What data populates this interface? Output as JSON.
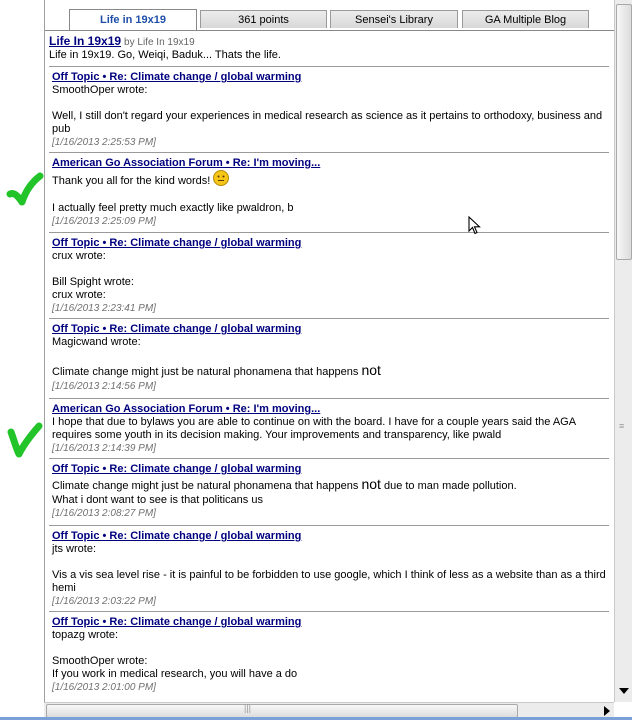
{
  "tabs": [
    {
      "label": "Life in 19x19",
      "active": true
    },
    {
      "label": "361 points",
      "active": false
    },
    {
      "label": "Sensei's Library",
      "active": false
    },
    {
      "label": "GA Multiple Blog",
      "active": false
    }
  ],
  "header": {
    "blog_title": "Life In 19x19",
    "byline": "by Life In 19x19",
    "tagline": "Life in 19x19. Go, Weiqi, Baduk... Thats the life."
  },
  "entries": [
    {
      "title": "Off Topic • Re: Climate change / global warming",
      "lines": [
        "SmoothOper wrote:",
        "",
        "Well, I still don't regard your experiences in medical research as science as it pertains to orthodoxy, business and pub"
      ],
      "stamp": "[1/16/2013 2:25:53 PM]"
    },
    {
      "title": "American Go Association Forum • Re: I'm moving...",
      "line1": "Thank you all for the kind words!",
      "line3": "I actually feel pretty much exactly like pwaldron, b",
      "stamp": "[1/16/2013 2:25:09 PM]"
    },
    {
      "title": "Off Topic • Re: Climate change / global warming",
      "lines": [
        "crux wrote:",
        "",
        "Bill Spight wrote:",
        "crux wrote:"
      ],
      "stamp": "[1/16/2013 2:23:41 PM]"
    },
    {
      "title": "Off Topic • Re: Climate change / global warming",
      "line1": "Magicwand wrote:",
      "line3_pre": "Climate change might just be natural phonamena that happens",
      "line3_big": "not",
      "stamp": "[1/16/2013 2:14:56 PM]"
    },
    {
      "title": "American Go Association Forum • Re: I'm moving...",
      "lines": [
        "I hope that due to bylaws you are able to continue on with the board. I have for a couple years said the AGA requires some youth in its decision making. Your improvements and transparency, like pwald"
      ],
      "stamp": "[1/16/2013 2:14:39 PM]"
    },
    {
      "title": "Off Topic • Re: Climate change / global warming",
      "line1_pre": "Climate change might just be natural phonamena that happens",
      "line1_big": "not",
      "line1_post": "due to man made pollution.",
      "line2": "What i dont want to see is that politicans us",
      "stamp": "[1/16/2013 2:08:27 PM]"
    },
    {
      "title": "Off Topic • Re: Climate change / global warming",
      "lines": [
        "jts wrote:",
        "",
        "Vis a vis sea level rise - it is painful to be forbidden to use google, which I think of less as a website than as a third hemi"
      ],
      "stamp": "[1/16/2013 2:03:22 PM]"
    },
    {
      "title": "Off Topic • Re: Climate change / global warming",
      "lines": [
        "topazg wrote:",
        "",
        "SmoothOper wrote:",
        "If you work in medical research, you will have a do"
      ],
      "stamp": "[1/16/2013 2:01:00 PM]"
    }
  ],
  "icons": {
    "check_mark": "green-check-icon",
    "smiley": "smiley-icon",
    "cursor": "arrow-cursor-icon"
  },
  "colors": {
    "link": "#00007f",
    "active_tab_text": "#1f4fa8",
    "check_mark": "#22c42a",
    "timestamp": "#707070"
  }
}
